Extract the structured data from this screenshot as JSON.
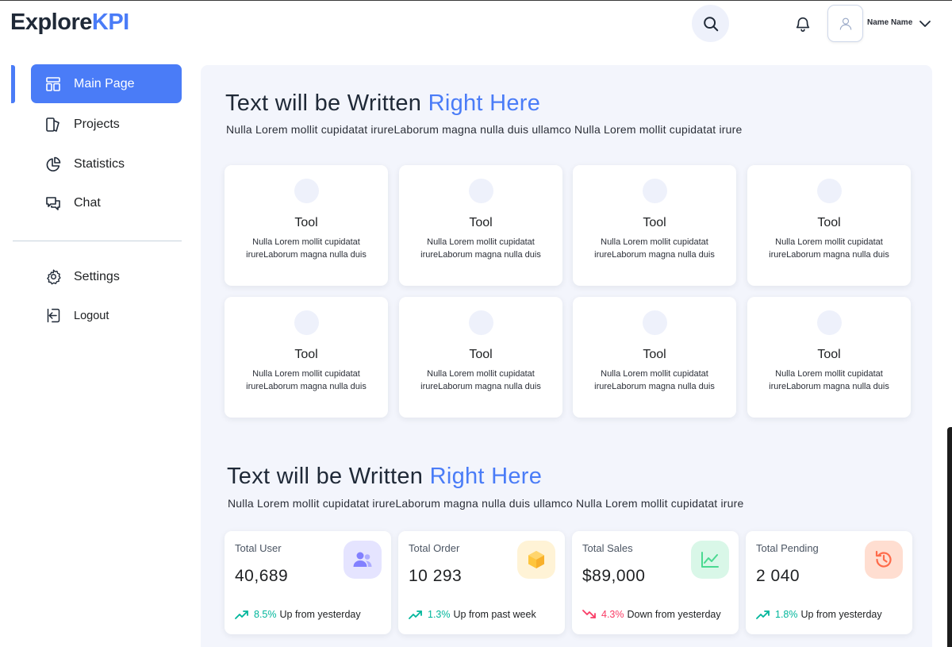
{
  "header": {
    "logo_main": "Explore",
    "logo_accent": "KPI",
    "user_name": "Name Name",
    "icons": [
      "search-icon",
      "bell-icon",
      "user-icon",
      "chevron-down-icon"
    ]
  },
  "sidebar": {
    "items": [
      {
        "label": "Main Page",
        "icon": "layout-icon",
        "active": true
      },
      {
        "label": "Projects",
        "icon": "projects-icon"
      },
      {
        "label": "Statistics",
        "icon": "pie-chart-icon"
      },
      {
        "label": "Chat",
        "icon": "chat-icon"
      }
    ],
    "bottom_items": [
      {
        "label": "Settings",
        "icon": "gear-icon"
      },
      {
        "label": "Logout",
        "icon": "logout-icon"
      }
    ]
  },
  "section1": {
    "title_main": "Text will be Written",
    "title_accent": "Right Here",
    "subtitle": "Nulla Lorem mollit cupidatat irureLaborum magna nulla duis ullamco Nulla Lorem mollit cupidatat irure"
  },
  "tools": [
    {
      "title": "Tool",
      "desc": "Nulla Lorem mollit cupidatat irureLaborum magna nulla duis"
    },
    {
      "title": "Tool",
      "desc": "Nulla Lorem mollit cupidatat irureLaborum magna nulla duis"
    },
    {
      "title": "Tool",
      "desc": "Nulla Lorem mollit cupidatat irureLaborum magna nulla duis"
    },
    {
      "title": "Tool",
      "desc": "Nulla Lorem mollit cupidatat irureLaborum magna nulla duis"
    },
    {
      "title": "Tool",
      "desc": "Nulla Lorem mollit cupidatat irureLaborum magna nulla duis"
    },
    {
      "title": "Tool",
      "desc": "Nulla Lorem mollit cupidatat irureLaborum magna nulla duis"
    },
    {
      "title": "Tool",
      "desc": "Nulla Lorem mollit cupidatat irureLaborum magna nulla duis"
    },
    {
      "title": "Tool",
      "desc": "Nulla Lorem mollit cupidatat irureLaborum magna nulla duis"
    }
  ],
  "section2": {
    "title_main": "Text will be Written",
    "title_accent": "Right Here",
    "subtitle": "Nulla Lorem mollit cupidatat irureLaborum magna nulla duis ullamco Nulla Lorem mollit cupidatat irure"
  },
  "stats": [
    {
      "label": "Total User",
      "value": "40,689",
      "pct": "8.5%",
      "trend_text": "Up from yesterday",
      "direction": "up",
      "icon": "users-icon",
      "icon_bg": "#e5e4ff",
      "icon_color": "#8280ff"
    },
    {
      "label": "Total Order",
      "value": "10 293",
      "pct": "1.3%",
      "trend_text": "Up from past week",
      "direction": "up",
      "icon": "box-icon",
      "icon_bg": "#fff3d6",
      "icon_color": "#fec53d"
    },
    {
      "label": "Total Sales",
      "value": "$89,000",
      "pct": "4.3%",
      "trend_text": "Down from yesterday",
      "direction": "down",
      "icon": "line-chart-icon",
      "icon_bg": "#d9f7e8",
      "icon_color": "#4ad991"
    },
    {
      "label": "Total Pending",
      "value": "2 040",
      "pct": "1.8%",
      "trend_text": "Up from yesterday",
      "direction": "up",
      "icon": "history-icon",
      "icon_bg": "#ffded1",
      "icon_color": "#ff9066"
    }
  ],
  "colors": {
    "accent": "#4a7cf7",
    "trend_up": "#00b69b",
    "trend_down": "#f93c65",
    "panel_bg": "#f3f5fc"
  }
}
